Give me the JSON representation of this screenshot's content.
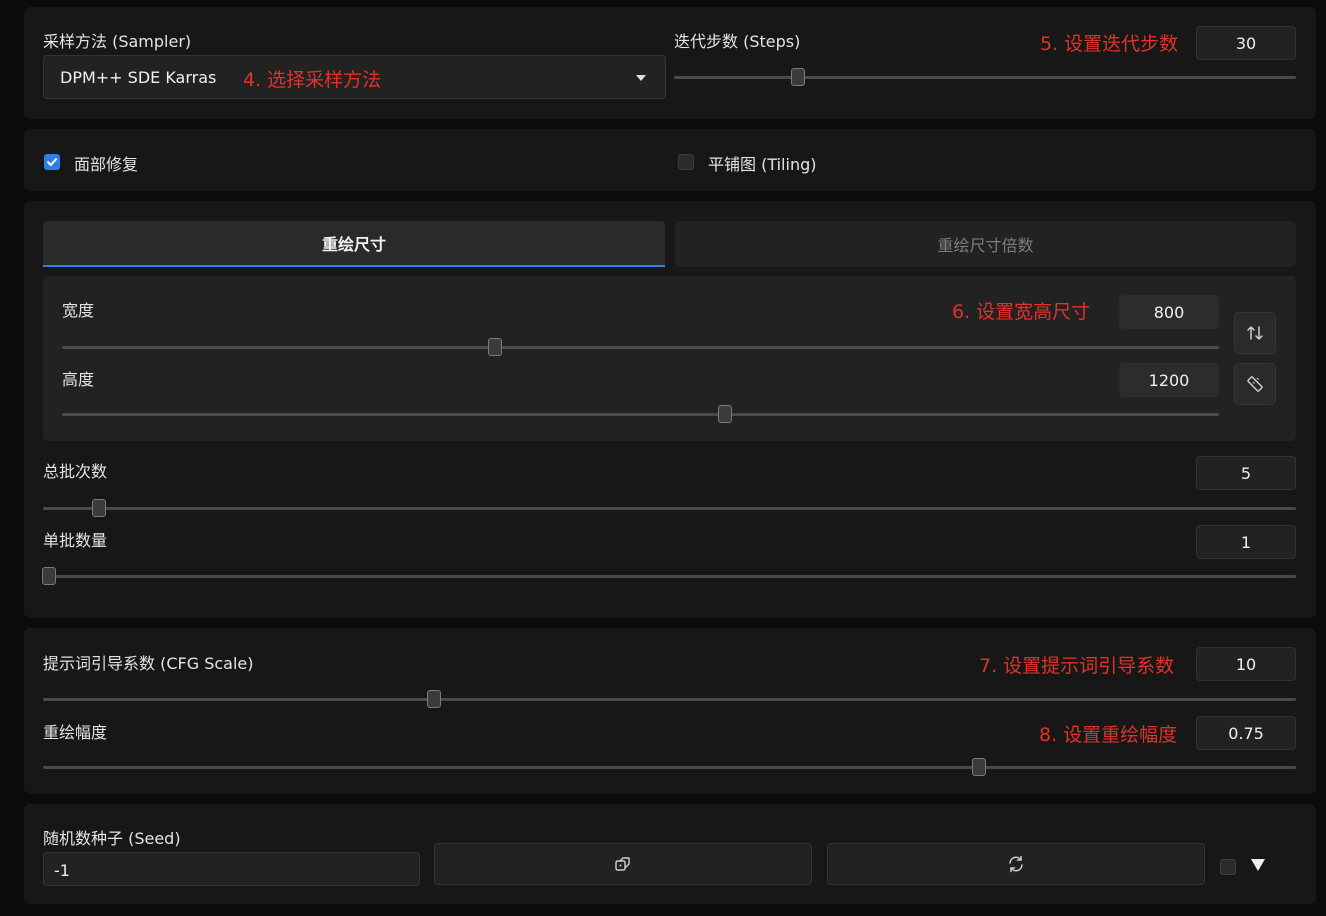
{
  "sampler": {
    "label": "采样方法 (Sampler)",
    "value": "DPM++ SDE Karras",
    "annotation": "4. 选择采样方法"
  },
  "steps": {
    "label": "迭代步数 (Steps)",
    "value": "30",
    "annotation": "5. 设置迭代步数",
    "level": 0.2
  },
  "options": {
    "face_restore_label": "面部修复",
    "face_restore_checked": true,
    "tiling_label": "平铺图 (Tiling)",
    "tiling_checked": false
  },
  "resize_tabs": {
    "tabs": [
      {
        "label": "重绘尺寸",
        "active": true
      },
      {
        "label": "重绘尺寸倍数",
        "active": false
      }
    ]
  },
  "width": {
    "label": "宽度",
    "value": "800",
    "annotation": "6. 设置宽高尺寸",
    "level": 0.374
  },
  "height": {
    "label": "高度",
    "value": "1200",
    "level": 0.573
  },
  "batch_count": {
    "label": "总批次数",
    "value": "5",
    "level": 0.045
  },
  "batch_size": {
    "label": "单批数量",
    "value": "1",
    "level": 0.005
  },
  "cfg_scale": {
    "label": "提示词引导系数 (CFG Scale)",
    "value": "10",
    "annotation": "7. 设置提示词引导系数",
    "level": 0.312
  },
  "denoise": {
    "label": "重绘幅度",
    "value": "0.75",
    "annotation": "8. 设置重绘幅度",
    "level": 0.747
  },
  "seed": {
    "label": "随机数种子 (Seed)",
    "value": "-1",
    "extra_checked": false
  },
  "icons": {
    "dropdown": "caret-down-icon",
    "swap": "swap-vertical-icon",
    "ruler": "ruler-icon",
    "dice": "dice-icon",
    "recycle": "recycle-icon",
    "expand": "triangle-down-icon"
  },
  "colors": {
    "accent": "#2f7fe8",
    "annotation": "#e0322a",
    "panel": "#171717",
    "background": "#0b0b0b"
  }
}
